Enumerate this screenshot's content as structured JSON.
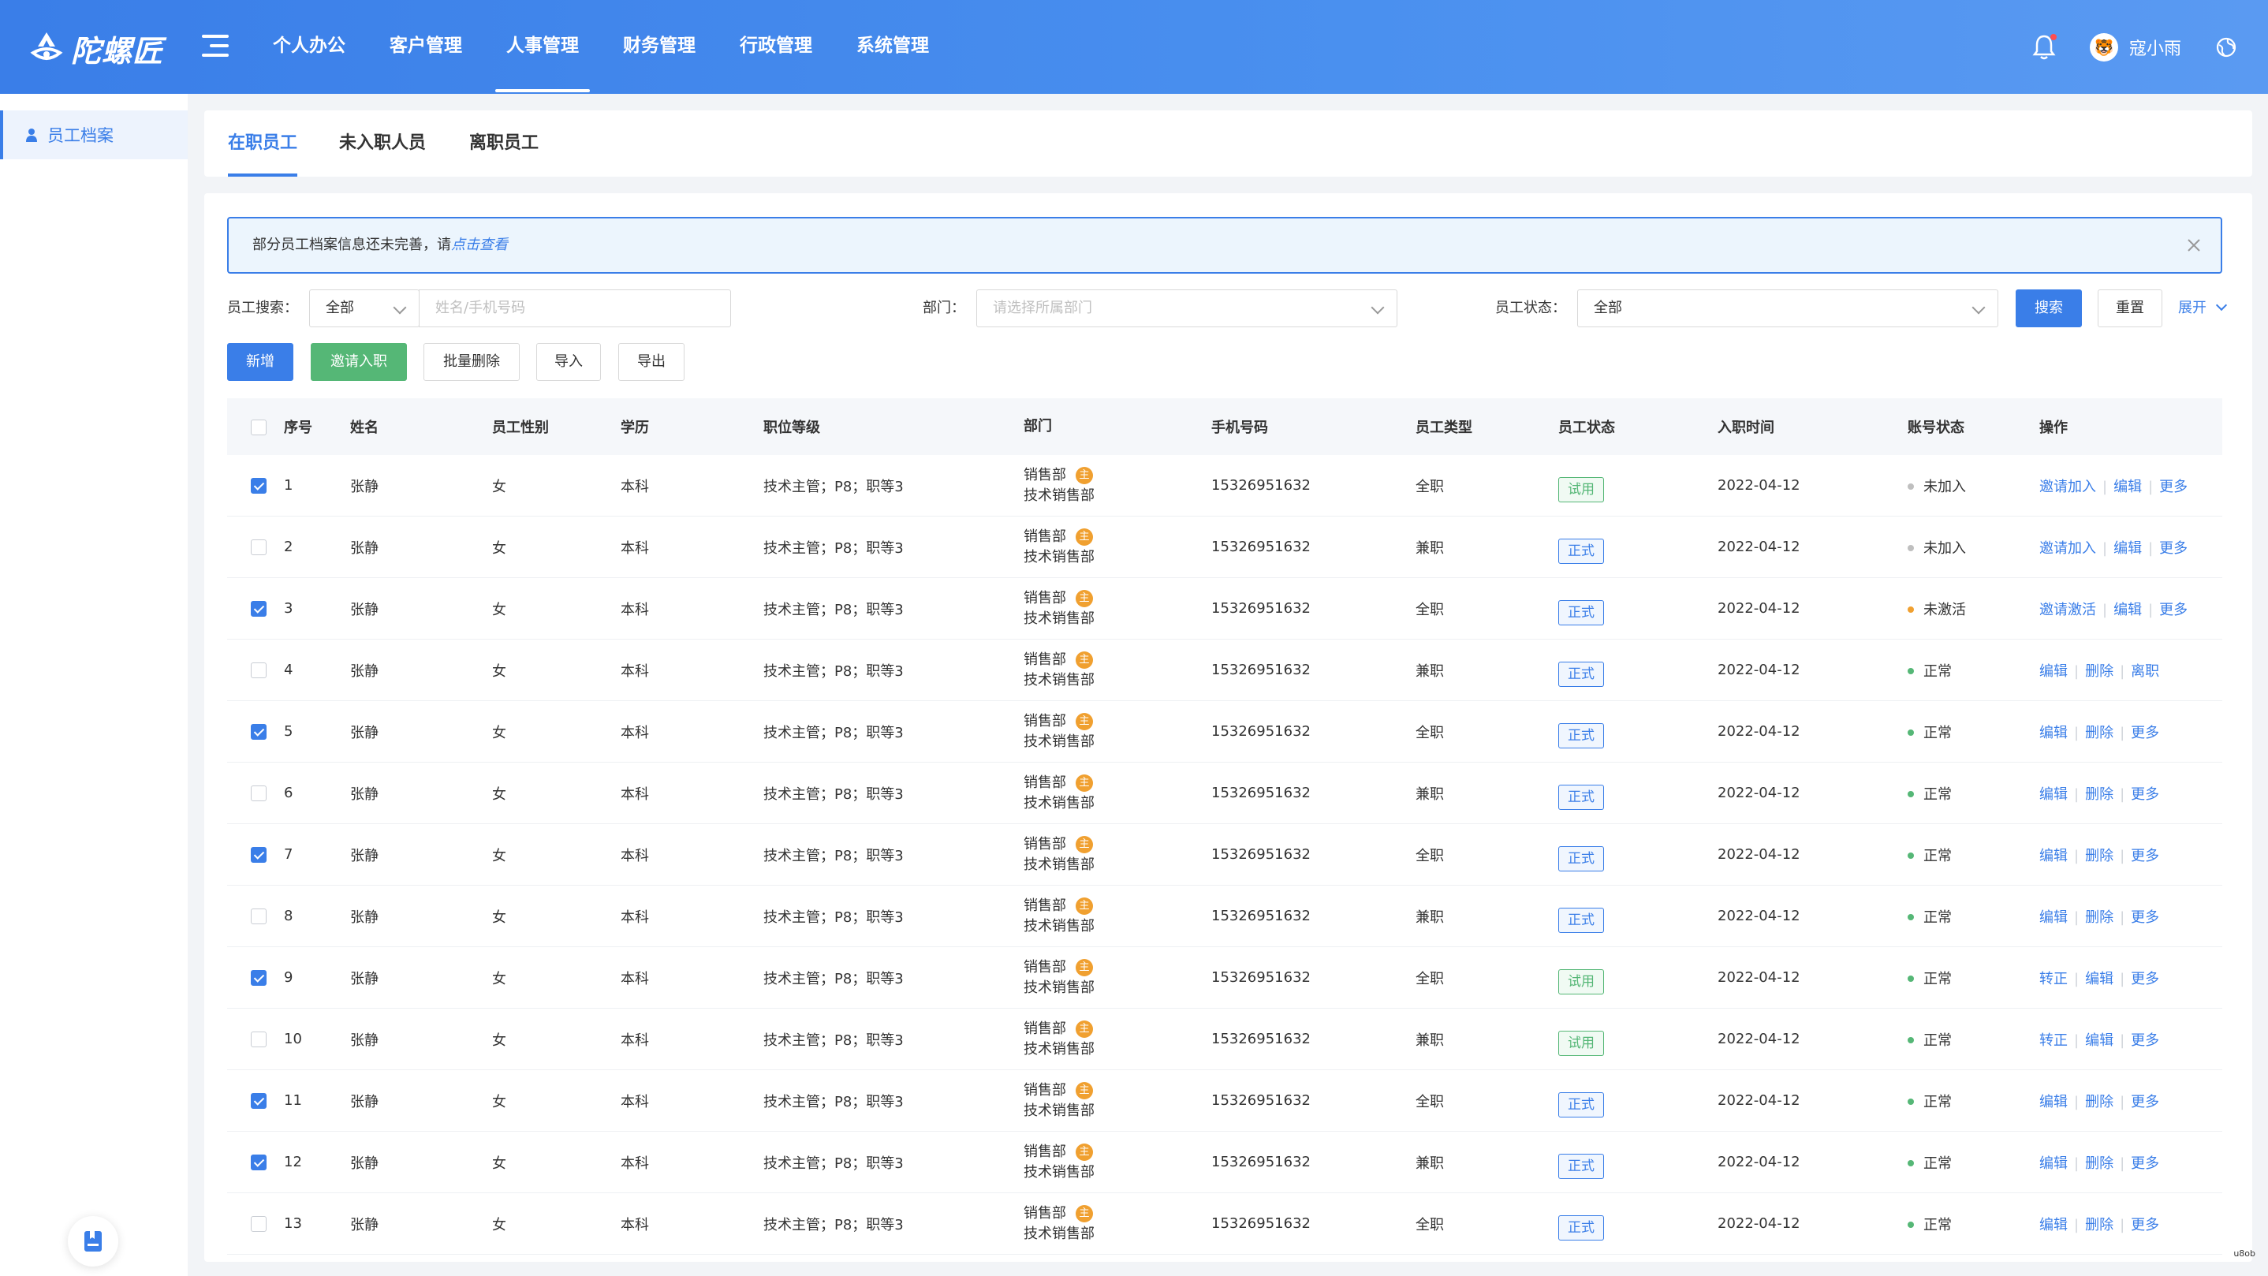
{
  "app": {
    "logo_text": "陀螺匠"
  },
  "nav": [
    "个人办公",
    "客户管理",
    "人事管理",
    "财务管理",
    "行政管理",
    "系统管理"
  ],
  "nav_active": 2,
  "user": {
    "name": "寇小雨",
    "avatar_char": "🐯"
  },
  "sidebar": {
    "items": [
      {
        "label": "员工档案"
      }
    ]
  },
  "tabs": [
    "在职员工",
    "未入职人员",
    "离职员工"
  ],
  "alert": {
    "text": "部分员工档案信息还未完善，请",
    "link": "点击查看"
  },
  "filters": {
    "search_label": "员工搜索：",
    "search_type": "全部",
    "search_placeholder": "姓名/手机号码",
    "dept_label": "部门：",
    "dept_placeholder": "请选择所属部门",
    "status_label": "员工状态：",
    "status_value": "全部",
    "search_btn": "搜索",
    "reset_btn": "重置",
    "expand": "展开"
  },
  "actions": {
    "add": "新增",
    "invite": "邀请入职",
    "batch_delete": "批量删除",
    "import": "导入",
    "export": "导出"
  },
  "table": {
    "headers": [
      "序号",
      "姓名",
      "员工性别",
      "学历",
      "职位等级",
      "部门",
      "手机号码",
      "员工类型",
      "员工状态",
      "入职时间",
      "账号状态",
      "操作"
    ],
    "dept_badge": "主",
    "rows": [
      {
        "checked": true,
        "no": "1",
        "name": "张静",
        "sex": "女",
        "edu": "本科",
        "level": "技术主管；P8；职等3",
        "dept1": "销售部",
        "dept2": "技术销售部",
        "phone": "15326951632",
        "type": "全职",
        "status": "试用",
        "date": "2022-04-12",
        "acct": "未加入",
        "ops": [
          "邀请加入",
          "编辑",
          "更多"
        ]
      },
      {
        "checked": false,
        "no": "2",
        "name": "张静",
        "sex": "女",
        "edu": "本科",
        "level": "技术主管；P8；职等3",
        "dept1": "销售部",
        "dept2": "技术销售部",
        "phone": "15326951632",
        "type": "兼职",
        "status": "正式",
        "date": "2022-04-12",
        "acct": "未加入",
        "ops": [
          "邀请加入",
          "编辑",
          "更多"
        ]
      },
      {
        "checked": true,
        "no": "3",
        "name": "张静",
        "sex": "女",
        "edu": "本科",
        "level": "技术主管；P8；职等3",
        "dept1": "销售部",
        "dept2": "技术销售部",
        "phone": "15326951632",
        "type": "全职",
        "status": "正式",
        "date": "2022-04-12",
        "acct": "未激活",
        "ops": [
          "邀请激活",
          "编辑",
          "更多"
        ]
      },
      {
        "checked": false,
        "no": "4",
        "name": "张静",
        "sex": "女",
        "edu": "本科",
        "level": "技术主管；P8；职等3",
        "dept1": "销售部",
        "dept2": "技术销售部",
        "phone": "15326951632",
        "type": "兼职",
        "status": "正式",
        "date": "2022-04-12",
        "acct": "正常",
        "ops": [
          "编辑",
          "删除",
          "离职"
        ]
      },
      {
        "checked": true,
        "no": "5",
        "name": "张静",
        "sex": "女",
        "edu": "本科",
        "level": "技术主管；P8；职等3",
        "dept1": "销售部",
        "dept2": "技术销售部",
        "phone": "15326951632",
        "type": "全职",
        "status": "正式",
        "date": "2022-04-12",
        "acct": "正常",
        "ops": [
          "编辑",
          "删除",
          "更多"
        ]
      },
      {
        "checked": false,
        "no": "6",
        "name": "张静",
        "sex": "女",
        "edu": "本科",
        "level": "技术主管；P8；职等3",
        "dept1": "销售部",
        "dept2": "技术销售部",
        "phone": "15326951632",
        "type": "兼职",
        "status": "正式",
        "date": "2022-04-12",
        "acct": "正常",
        "ops": [
          "编辑",
          "删除",
          "更多"
        ]
      },
      {
        "checked": true,
        "no": "7",
        "name": "张静",
        "sex": "女",
        "edu": "本科",
        "level": "技术主管；P8；职等3",
        "dept1": "销售部",
        "dept2": "技术销售部",
        "phone": "15326951632",
        "type": "全职",
        "status": "正式",
        "date": "2022-04-12",
        "acct": "正常",
        "ops": [
          "编辑",
          "删除",
          "更多"
        ]
      },
      {
        "checked": false,
        "no": "8",
        "name": "张静",
        "sex": "女",
        "edu": "本科",
        "level": "技术主管；P8；职等3",
        "dept1": "销售部",
        "dept2": "技术销售部",
        "phone": "15326951632",
        "type": "兼职",
        "status": "正式",
        "date": "2022-04-12",
        "acct": "正常",
        "ops": [
          "编辑",
          "删除",
          "更多"
        ]
      },
      {
        "checked": true,
        "no": "9",
        "name": "张静",
        "sex": "女",
        "edu": "本科",
        "level": "技术主管；P8；职等3",
        "dept1": "销售部",
        "dept2": "技术销售部",
        "phone": "15326951632",
        "type": "全职",
        "status": "试用",
        "date": "2022-04-12",
        "acct": "正常",
        "ops": [
          "转正",
          "编辑",
          "更多"
        ]
      },
      {
        "checked": false,
        "no": "10",
        "name": "张静",
        "sex": "女",
        "edu": "本科",
        "level": "技术主管；P8；职等3",
        "dept1": "销售部",
        "dept2": "技术销售部",
        "phone": "15326951632",
        "type": "兼职",
        "status": "试用",
        "date": "2022-04-12",
        "acct": "正常",
        "ops": [
          "转正",
          "编辑",
          "更多"
        ]
      },
      {
        "checked": true,
        "no": "11",
        "name": "张静",
        "sex": "女",
        "edu": "本科",
        "level": "技术主管；P8；职等3",
        "dept1": "销售部",
        "dept2": "技术销售部",
        "phone": "15326951632",
        "type": "全职",
        "status": "正式",
        "date": "2022-04-12",
        "acct": "正常",
        "ops": [
          "编辑",
          "删除",
          "更多"
        ]
      },
      {
        "checked": true,
        "no": "12",
        "name": "张静",
        "sex": "女",
        "edu": "本科",
        "level": "技术主管；P8；职等3",
        "dept1": "销售部",
        "dept2": "技术销售部",
        "phone": "15326951632",
        "type": "兼职",
        "status": "正式",
        "date": "2022-04-12",
        "acct": "正常",
        "ops": [
          "编辑",
          "删除",
          "更多"
        ]
      },
      {
        "checked": false,
        "no": "13",
        "name": "张静",
        "sex": "女",
        "edu": "本科",
        "level": "技术主管；P8；职等3",
        "dept1": "销售部",
        "dept2": "技术销售部",
        "phone": "15326951632",
        "type": "全职",
        "status": "正式",
        "date": "2022-04-12",
        "acct": "正常",
        "ops": [
          "编辑",
          "删除",
          "更多"
        ]
      }
    ]
  },
  "status_colors": {
    "试用": "#55b776",
    "正式": "#3a7ee8",
    "未加入": "#bfbfbf",
    "未激活": "#f0a030",
    "正常": "#55b776"
  },
  "corner_tag": "u8ob"
}
